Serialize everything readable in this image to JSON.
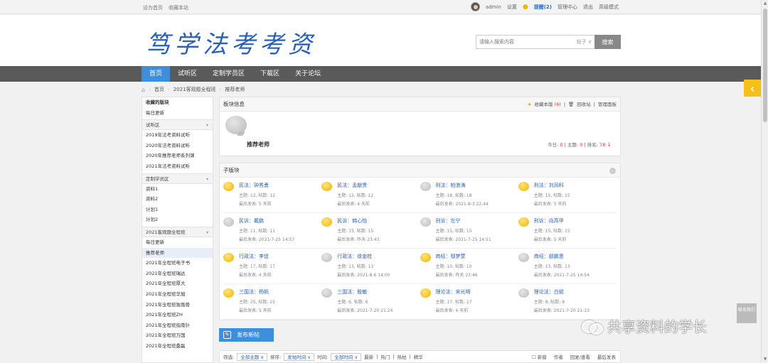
{
  "topbar": {
    "set_home": "设为首页",
    "bookmark": "收藏本站",
    "username": "admin",
    "settings": "设置",
    "remind": "提醒(2)",
    "admin_center": "管理中心",
    "logout": "退出",
    "advanced_mode": "高级模式"
  },
  "header": {
    "logo_text": "笃学法考考资",
    "search_placeholder": "请输入搜索内容",
    "search_type": "帖子",
    "search_button": "搜索"
  },
  "nav": {
    "items": [
      "首页",
      "试听区",
      "定制学员区",
      "下载区",
      "关于论坛"
    ]
  },
  "breadcrumb": [
    "首页",
    "2021客观题全程班",
    "推荐老师"
  ],
  "sidebar": {
    "fav_title": "收藏的版块",
    "fav_items": [
      "每日更新"
    ],
    "groups": [
      {
        "title": "试听区",
        "items": [
          "2019年法考资料试听",
          "2020年法考资料试听",
          "2020年推荐老师系列课",
          "2021年法考资料试听"
        ]
      },
      {
        "title": "定制学员区",
        "items": [
          "资料1",
          "资料2",
          "计划1",
          "计划2"
        ]
      },
      {
        "title": "2021客观题全程班",
        "items": [
          "每日更新",
          "推荐老师",
          "2021年全程班电子书",
          "2021年全程班瑞达",
          "2021年全程班厚大",
          "2021年全程班华旭",
          "2021年全程班独角兽",
          "2021年全程班ZH",
          "2021年全程班指南针",
          "2021年全程班万国",
          "2021年全程班桑磊"
        ]
      }
    ]
  },
  "forum": {
    "panel_title": "板块信息",
    "fav_label": "收藏本版",
    "fav_count": "(6)",
    "recycle": "回收站",
    "manage": "管理面板",
    "name": "推荐老师",
    "today_label": "今日: ",
    "today": "0",
    "topics_label": "主题: ",
    "topics": "0",
    "rank_label": "排名: ",
    "rank": "78"
  },
  "subforums": {
    "title": "子版块",
    "items": [
      {
        "name": "民法：钟秀勇",
        "stats": "主题: 12, 帖数: 12",
        "last": "最后发表: 5 天前",
        "icon": "gold"
      },
      {
        "name": "民法：孟献贵",
        "stats": "主题: 12, 帖数: 12",
        "last": "最后发表: 4 天前",
        "icon": "gold"
      },
      {
        "name": "刑法：柏浪涛",
        "stats": "主题: 18, 帖数: 18",
        "last": "最后发表: 2021-8-3 22:44",
        "icon": "gray"
      },
      {
        "name": "刑法：刘凤科",
        "stats": "主题: 15, 帖数: 15",
        "last": "最后发表: 5 天前",
        "icon": "gold"
      },
      {
        "name": "民诉：戴鹏",
        "stats": "主题: 11, 帖数: 11",
        "last": "最后发表: 2021-7-25 14:57",
        "icon": "gray"
      },
      {
        "name": "民诉：韩心怡",
        "stats": "主题: 15, 帖数: 15",
        "last": "最后发表: 昨天 23:43",
        "icon": "gold"
      },
      {
        "name": "刑诉：左宁",
        "stats": "主题: 15, 帖数: 15",
        "last": "最后发表: 2021-7-25 14:51",
        "icon": "gray"
      },
      {
        "name": "刑诉：向高甲",
        "stats": "主题: 15, 帖数: 15",
        "last": "最后发表: 5 天前",
        "icon": "gold"
      },
      {
        "name": "行政法：李佳",
        "stats": "主题: 17, 帖数: 17",
        "last": "最后发表: 4 天前",
        "icon": "gold"
      },
      {
        "name": "行政法：徐金桂",
        "stats": "主题: 13, 帖数: 13",
        "last": "最后发表: 2021-8-6 14:00",
        "icon": "gray"
      },
      {
        "name": "商经：鄢梦萱",
        "stats": "主题: 10, 帖数: 10",
        "last": "最后发表: 昨天 23:46",
        "icon": "gold"
      },
      {
        "name": "商经：郄鹏恩",
        "stats": "主题: 13, 帖数: 13",
        "last": "最后发表: 2021-7-25 14:54",
        "icon": "gray"
      },
      {
        "name": "三国法：杨帆",
        "stats": "主题: 25, 帖数: 25",
        "last": "最后发表: 5 天前",
        "icon": "gold"
      },
      {
        "name": "三国法：殷敏",
        "stats": "主题: 6, 帖数: 6",
        "last": "最后发表: 2021-7-20 21:24",
        "icon": "gray"
      },
      {
        "name": "理论法：宋光明",
        "stats": "主题: 17, 帖数: 17",
        "last": "最后发表: 4 天前",
        "icon": "gold"
      },
      {
        "name": "理论法：白斌",
        "stats": "主题: 8, 帖数: 8",
        "last": "最后发表: 2021-7-20 21:13",
        "icon": "gray"
      }
    ]
  },
  "post_button": "发布新帖",
  "filter": {
    "filter_label": "筛选:",
    "all_topics": "全部主题",
    "sort_label": "排序:",
    "sort_value": "发帖时间",
    "time_label": "时间:",
    "time_value": "全部时间",
    "latest": "最新",
    "hot": "热门",
    "hot_posts": "热帖",
    "digest": "精华",
    "new_window": "新窗",
    "author": "作者",
    "replies_views": "回复/查看",
    "last_post": "最后发表"
  },
  "float": {
    "feedback": "联系我们",
    "watermark": "共享资料的学长"
  }
}
